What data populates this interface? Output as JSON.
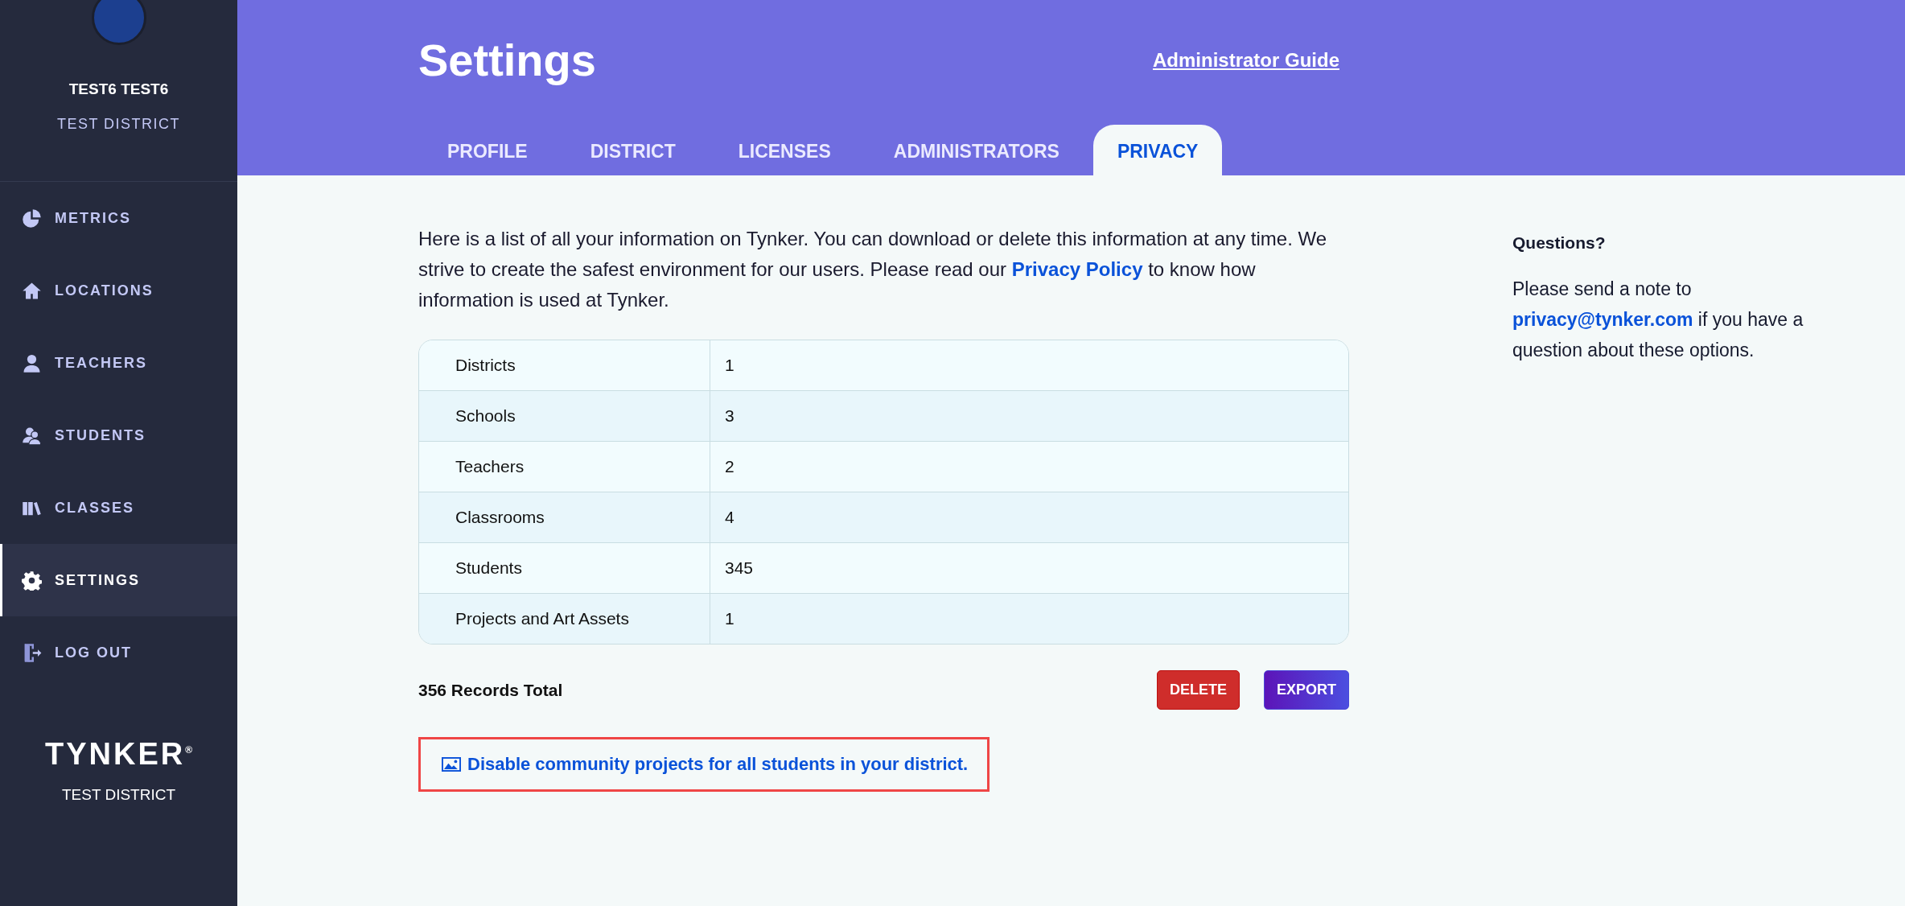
{
  "sidebar": {
    "user_name": "TEST6 TEST6",
    "user_district": "TEST DISTRICT",
    "items": [
      {
        "label": "METRICS",
        "kind": "metrics",
        "selected": false
      },
      {
        "label": "LOCATIONS",
        "kind": "locations",
        "selected": false
      },
      {
        "label": "TEACHERS",
        "kind": "teachers",
        "selected": false
      },
      {
        "label": "STUDENTS",
        "kind": "students",
        "selected": false
      },
      {
        "label": "CLASSES",
        "kind": "classes",
        "selected": false
      },
      {
        "label": "SETTINGS",
        "kind": "settings",
        "selected": true
      },
      {
        "label": "LOG OUT",
        "kind": "logout",
        "selected": false
      }
    ],
    "logo": "TYNKER",
    "logo_mark": "®",
    "footer_district": "TEST DISTRICT"
  },
  "header": {
    "title": "Settings",
    "guide_link": "Administrator Guide",
    "tabs": [
      {
        "label": "PROFILE",
        "selected": false
      },
      {
        "label": "DISTRICT",
        "selected": false
      },
      {
        "label": "LICENSES",
        "selected": false
      },
      {
        "label": "ADMINISTRATORS",
        "selected": false
      },
      {
        "label": "PRIVACY",
        "selected": true
      }
    ]
  },
  "intro": {
    "before": "Here is a list of all your information on Tynker. You can download or delete this information at any time. We strive to create the safest environment for our users. Please read our ",
    "link": "Privacy Policy",
    "after": " to know how information is used at Tynker."
  },
  "table": {
    "rows": [
      {
        "label": "Districts",
        "value": "1"
      },
      {
        "label": "Schools",
        "value": "3"
      },
      {
        "label": "Teachers",
        "value": "2"
      },
      {
        "label": "Classrooms",
        "value": "4"
      },
      {
        "label": "Students",
        "value": "345"
      },
      {
        "label": "Projects and Art Assets",
        "value": "1"
      }
    ]
  },
  "total": "356 Records Total",
  "buttons": [
    {
      "label": "DELETE",
      "kind": "danger"
    },
    {
      "label": "EXPORT",
      "kind": "primary"
    }
  ],
  "community_link": "Disable community projects for all students in your district.",
  "questions": {
    "title": "Questions?",
    "before": "Please send a note to ",
    "link": "privacy@tynker.com",
    "after": " if you have a question about these options."
  }
}
